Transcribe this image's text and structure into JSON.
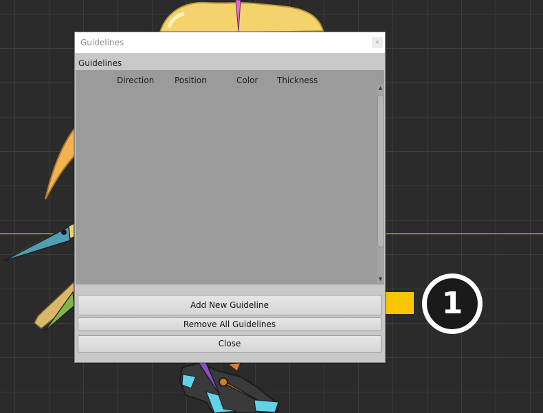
{
  "dialog": {
    "title": "Guidelines",
    "close_glyph": "×",
    "section_label": "Guidelines",
    "columns": [
      "Direction",
      "Position",
      "Color",
      "Thickness"
    ],
    "buttons": {
      "add": "Add New Guideline",
      "remove_all": "Remove All Guidelines",
      "close": "Close"
    }
  },
  "scrollbar": {
    "up_glyph": "▲",
    "down_glyph": "▼"
  },
  "annotation": {
    "step_number": "1",
    "arrow_color": "#f7c600",
    "badge_color": "#1a1a1a"
  },
  "canvas": {
    "background": "#2b2b2b",
    "guideline_color": "#d6d36a"
  }
}
